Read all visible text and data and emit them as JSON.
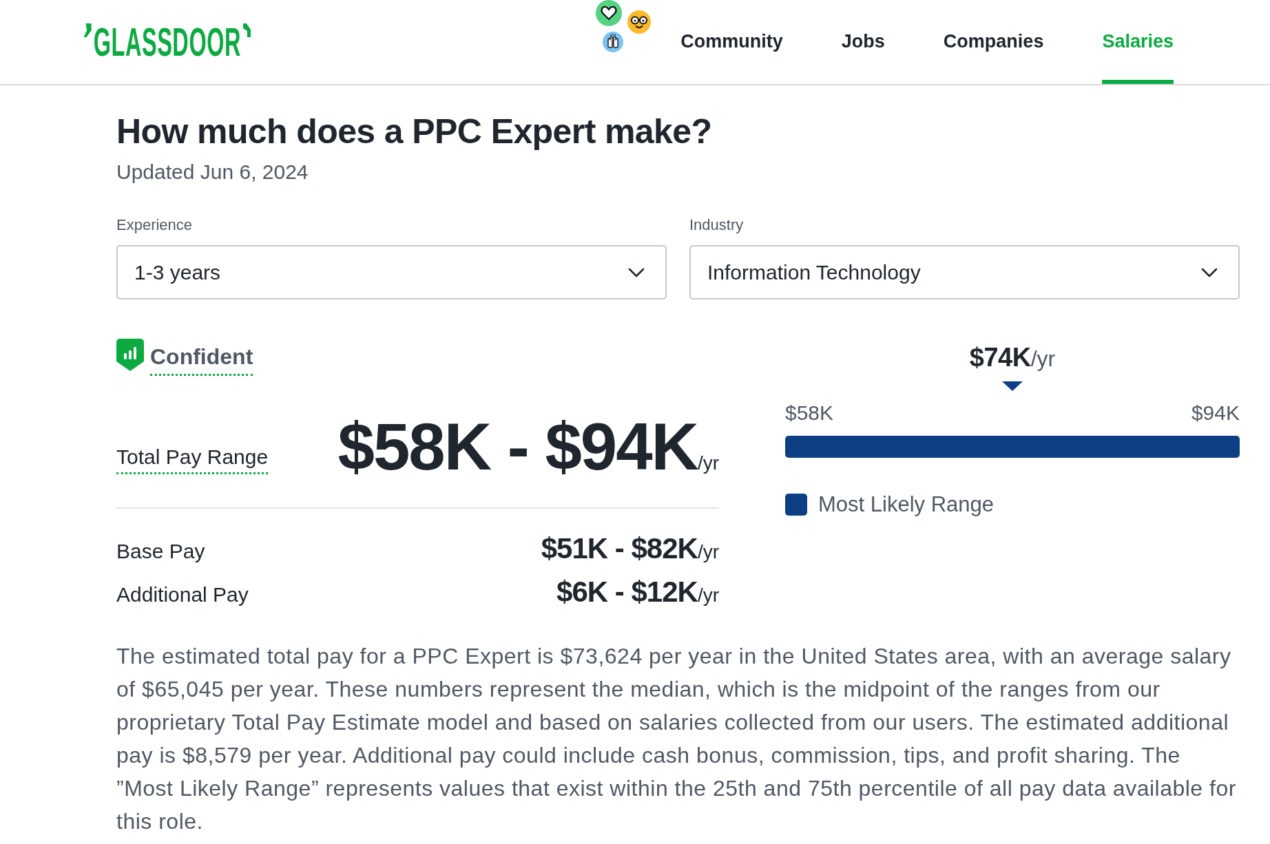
{
  "header": {
    "logo": "GLASSDOOR",
    "nav": [
      {
        "label": "Community",
        "selected": false
      },
      {
        "label": "Jobs",
        "selected": false
      },
      {
        "label": "Companies",
        "selected": false
      },
      {
        "label": "Salaries",
        "selected": true
      }
    ]
  },
  "page": {
    "title": "How much does a PPC Expert make?",
    "updated": "Updated Jun 6, 2024"
  },
  "filters": [
    {
      "label": "Experience",
      "value": "1-3 years"
    },
    {
      "label": "Industry",
      "value": "Information Technology"
    }
  ],
  "confidence": {
    "label": "Confident"
  },
  "total_pay": {
    "label": "Total Pay Range",
    "value": "$58K - $94K",
    "unit": "/yr"
  },
  "breakdown": [
    {
      "label": "Base Pay",
      "value": "$51K - $82K",
      "unit": "/yr"
    },
    {
      "label": "Additional Pay",
      "value": "$6K - $12K",
      "unit": "/yr"
    }
  ],
  "range_chart": {
    "median": "$74K",
    "median_unit": "/yr",
    "low": "$58K",
    "high": "$94K",
    "legend": "Most Likely Range"
  },
  "description": "The estimated total pay for a PPC Expert is $73,624 per year in the United States area, with an average salary of $65,045 per year. These numbers represent the median, which is the midpoint of the ranges from our proprietary Total Pay Estimate model and based on salaries collected from our users. The estimated additional pay is $8,579 per year. Additional pay could include cash bonus, commission, tips, and profit sharing. The ”Most Likely Range” represents values that exist within the 25th and 75th percentile of all pay data available for this role."
}
